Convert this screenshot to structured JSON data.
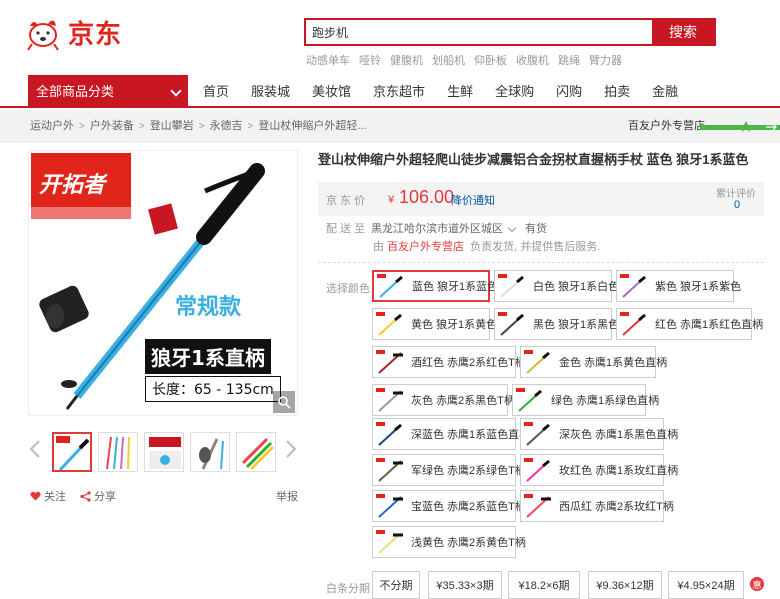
{
  "header": {
    "logo_text": "京东",
    "search_value": "跑步机",
    "search_button": "搜索",
    "hot_words": [
      "动感单车",
      "哑铃",
      "健腹机",
      "划船机",
      "仰卧板",
      "收腹机",
      "跳绳",
      "臂力器"
    ]
  },
  "nav": {
    "all_categories": "全部商品分类",
    "items": [
      "首页",
      "服装城",
      "美妆馆",
      "京东超市",
      "生鲜",
      "全球购",
      "闪购",
      "拍卖",
      "金融"
    ]
  },
  "breadcrumb": {
    "items": [
      "运动户外",
      "户外装备",
      "登山攀岩",
      "永德吉",
      "登山杖伸缩户外超轻..."
    ],
    "shop": "百友户外专营店"
  },
  "gallery": {
    "brand_badge": "开拓者",
    "tag_normal": "常规款",
    "tag_model": "狼牙1系直柄",
    "tag_length": "长度：65 - 135cm"
  },
  "actions": {
    "follow": "关注",
    "share": "分享",
    "report": "举报"
  },
  "product": {
    "title": "登山杖伸缩户外超轻爬山徒步减震铝合金拐杖直握柄手杖 蓝色 狼牙1系蓝色",
    "price_label": "京 东 价",
    "currency": "¥",
    "price": "106.00",
    "price_notify": "降价通知",
    "review_label": "累计评价",
    "review_count": "0",
    "ship_label": "配 送 至",
    "ship_region": "黑龙江哈尔滨市道外区城区",
    "stock": "有货",
    "seller_prefix": "由",
    "seller_shop": "百友户外专营店",
    "seller_suffix": "负责发货, 并提供售后服务.",
    "color_label": "选择颜色",
    "colors": [
      "蓝色 狼牙1系蓝色",
      "白色 狼牙1系白色",
      "紫色 狼牙1系紫色",
      "黄色 狼牙1系黄色",
      "黑色 狼牙1系黑色",
      "红色 赤鹰1系红色直柄",
      "酒红色 赤鹰2系红色T柄",
      "金色 赤鹰1系黄色直柄",
      "灰色 赤鹰2系黑色T柄",
      "绿色 赤鹰1系绿色直柄",
      "深蓝色 赤鹰1系蓝色直柄",
      "深灰色 赤鹰1系黑色直柄",
      "军绿色 赤鹰2系绿色T柄",
      "玫红色 赤鹰1系玫红直柄",
      "宝蓝色 赤鹰2系蓝色T柄",
      "西瓜红 赤鹰2系玫红T柄",
      "浅黄色 赤鹰2系黄色T柄"
    ],
    "installment_label": "白条分期",
    "installments": [
      "不分期",
      "¥35.33×3期",
      "¥18.2×6期",
      "¥9.36×12期",
      "¥4.95×24期"
    ],
    "hui": "惠"
  },
  "colors_theme": {
    "brand_red": "#e4393c",
    "nav_red": "#c81623",
    "link_blue": "#005aa0",
    "pole_blue": "#3ab0e2"
  }
}
